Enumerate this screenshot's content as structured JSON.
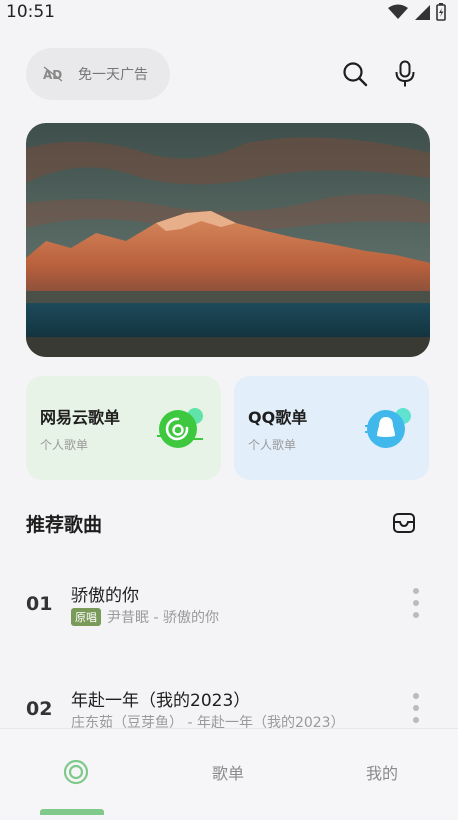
{
  "status_bar": {
    "time": "10:51"
  },
  "header": {
    "adfree_label": "免一天广告",
    "icons": [
      "ad-off-icon",
      "search-icon",
      "microphone-icon"
    ]
  },
  "banner": {
    "description_icon": "mountain-lake-banner"
  },
  "cards": [
    {
      "title": "网易云歌单",
      "subtitle": "个人歌单",
      "icon": "netease-music-icon",
      "color": "#e7f3e6"
    },
    {
      "title": "QQ歌单",
      "subtitle": "个人歌单",
      "icon": "qq-penguin-icon",
      "color": "#e2effa"
    }
  ],
  "recommended": {
    "title": "推荐歌曲",
    "songs": [
      {
        "index": "01",
        "title": "骄傲的你",
        "badge": "原唱",
        "meta": "尹昔眠 - 骄傲的你"
      },
      {
        "index": "02",
        "title": "年赴一年（我的2023）",
        "badge": "",
        "meta": "庄东茹（豆芽鱼） - 年赴一年（我的2023）"
      }
    ]
  },
  "tabs": [
    {
      "label": "",
      "icon": "home-ring-icon",
      "active": true
    },
    {
      "label": "歌单",
      "active": false
    },
    {
      "label": "我的",
      "active": false
    }
  ],
  "colors": {
    "accent": "#7fc98a",
    "netease_green": "#3dc83f",
    "qq_blue": "#41b8ec",
    "badge": "#7a9a5a"
  }
}
